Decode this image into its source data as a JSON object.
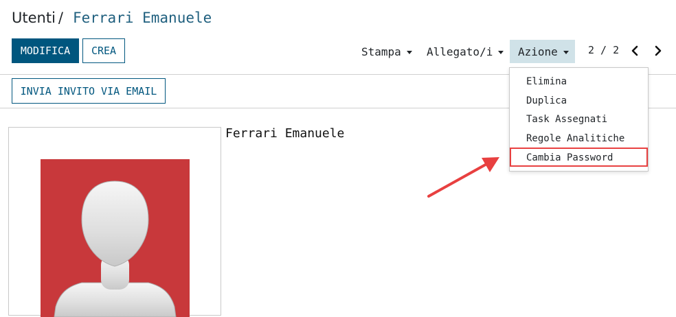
{
  "breadcrumb": {
    "root": "Utenti",
    "separator": "/",
    "current": "Ferrari Emanuele"
  },
  "toolbar": {
    "edit_label": "MODIFICA",
    "create_label": "CREA",
    "invite_label": "INVIA INVITO VIA EMAIL"
  },
  "menus": {
    "print_label": "Stampa",
    "attachments_label": "Allegato/i",
    "action_label": "Azione"
  },
  "pager": {
    "text": "2 / 2"
  },
  "action_dropdown": {
    "items": [
      {
        "label": "Elimina"
      },
      {
        "label": "Duplica"
      },
      {
        "label": "Task Assegnati"
      },
      {
        "label": "Regole Analitiche"
      },
      {
        "label": "Cambia Password"
      }
    ],
    "highlighted_item": "Cambia Password"
  },
  "record": {
    "name": "Ferrari Emanuele"
  },
  "colors": {
    "primary": "#00567e",
    "breadcrumb_link": "#1f5f7e",
    "active_menu_bg": "#d0e2e8",
    "annotation_red": "#e84040",
    "avatar_bg": "#c8383b"
  },
  "icons": {
    "prev": "chevron-left-icon",
    "next": "chevron-right-icon",
    "caret": "caret-down-icon",
    "avatar": "default-avatar-icon"
  }
}
